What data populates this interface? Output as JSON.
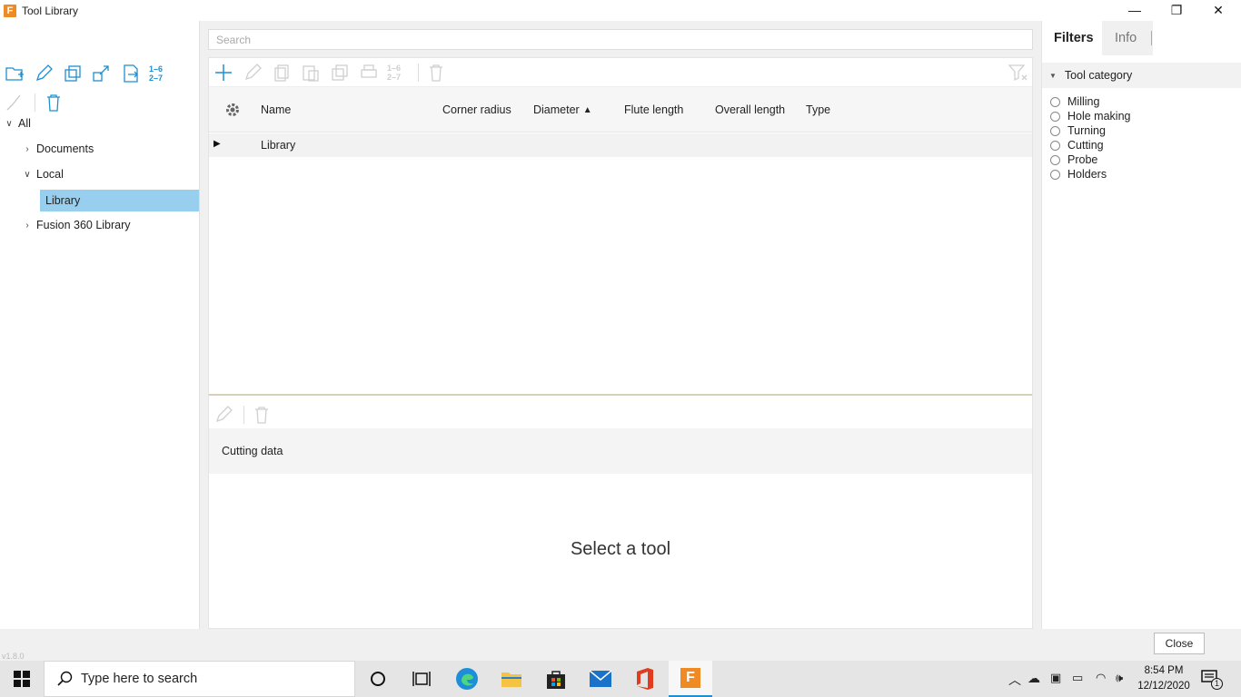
{
  "window": {
    "title": "Tool Library",
    "app_icon_letter": "F",
    "controls": {
      "minimize": "—",
      "restore": "❐",
      "close": "✕"
    }
  },
  "left_toolbar": {
    "icons": [
      "new-folder-icon",
      "edit-pencil-icon",
      "duplicate-icon",
      "export-icon",
      "import-icon",
      "renumber-icon",
      "broom-icon",
      "trash-icon"
    ],
    "renumber_text": "1–6 2–7"
  },
  "tree": {
    "root": "All",
    "items": [
      {
        "label": "Documents",
        "expanded": false
      },
      {
        "label": "Local",
        "expanded": true
      },
      {
        "label": "Library",
        "selected": true
      },
      {
        "label": "Fusion 360 Library",
        "expanded": false
      }
    ]
  },
  "search": {
    "placeholder": "Search"
  },
  "grid": {
    "columns": [
      "Name",
      "Corner radius",
      "Diameter",
      "Flute length",
      "Overall length",
      "Type"
    ],
    "sorted_column": "Diameter",
    "rows": [
      {
        "name": "Library"
      }
    ]
  },
  "detail": {
    "section_title": "Cutting data",
    "empty_message": "Select a tool"
  },
  "right_panel": {
    "tabs": [
      "Filters",
      "Info"
    ],
    "active_tab": "Filters",
    "filter_title": "Tool category",
    "categories": [
      "Milling",
      "Hole making",
      "Turning",
      "Cutting",
      "Probe",
      "Holders"
    ]
  },
  "footer": {
    "version": "v1.8.0",
    "close_label": "Close"
  },
  "taskbar": {
    "search_placeholder": "Type here to search",
    "time": "8:54 PM",
    "date": "12/12/2020",
    "notification_count": "1"
  },
  "colors": {
    "accent": "#1f8fcf",
    "selection": "#99cfee",
    "fusion_orange": "#f08a24"
  }
}
